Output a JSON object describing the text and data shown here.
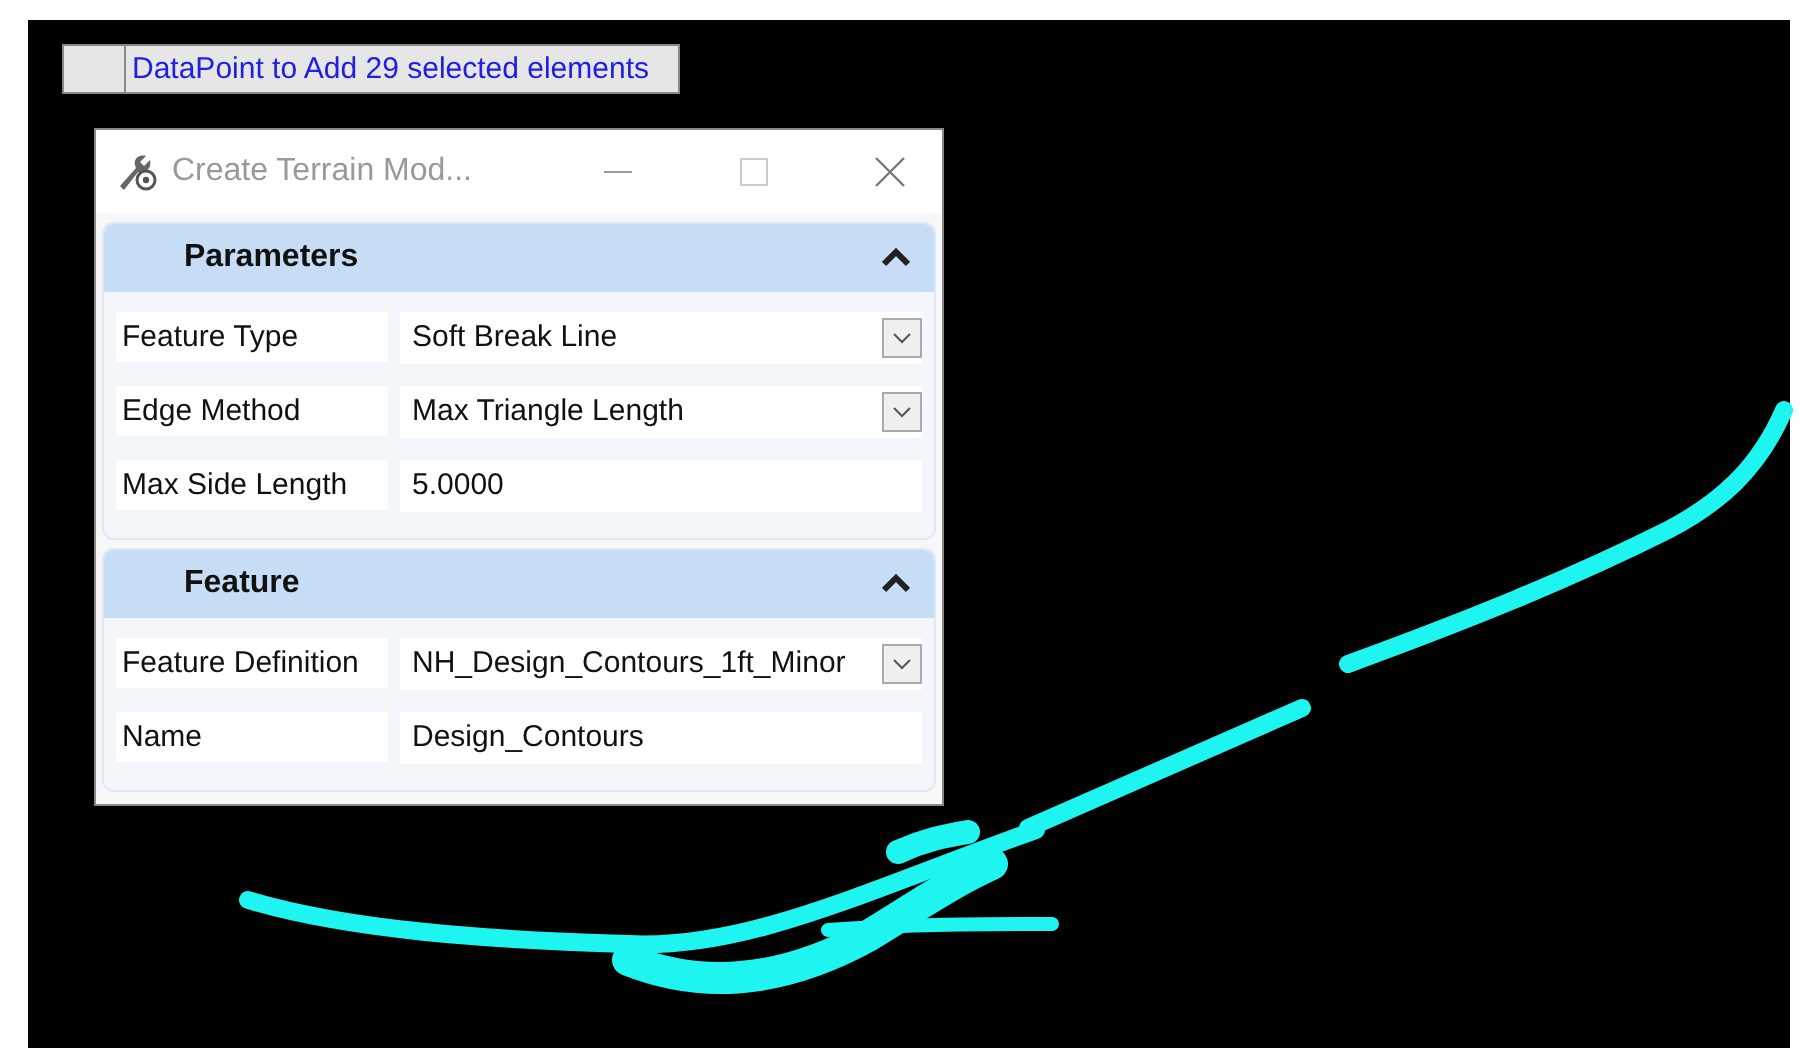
{
  "status_prompt": "DataPoint to Add 29 selected elements",
  "dialog": {
    "title": "Create Terrain Mod...",
    "sections": [
      {
        "title": "Parameters",
        "expanded": true,
        "fields": [
          {
            "label": "Feature Type",
            "value": "Soft Break Line",
            "kind": "dropdown"
          },
          {
            "label": "Edge Method",
            "value": "Max Triangle Length",
            "kind": "dropdown"
          },
          {
            "label": "Max Side Length",
            "value": "5.0000",
            "kind": "text"
          }
        ]
      },
      {
        "title": "Feature",
        "expanded": true,
        "fields": [
          {
            "label": "Feature Definition",
            "value": "NH_Design_Contours_1ft_Minor",
            "kind": "dropdown"
          },
          {
            "label": "Name",
            "value": "Design_Contours",
            "kind": "text"
          }
        ]
      }
    ]
  }
}
